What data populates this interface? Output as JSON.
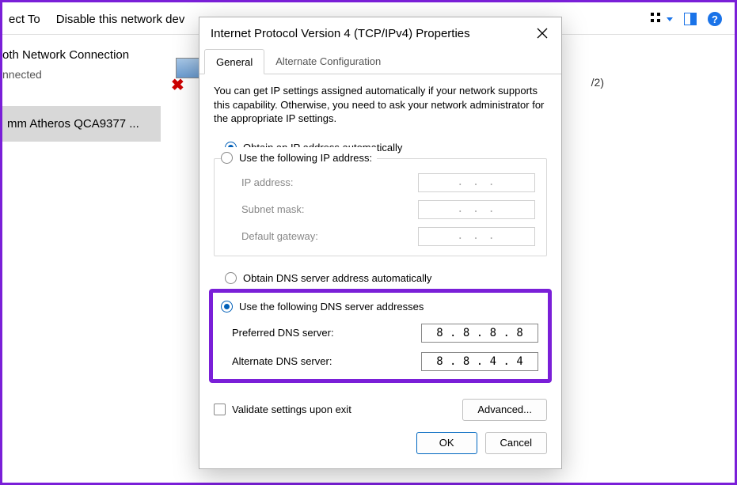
{
  "toolbar": {
    "connect_to": "ect To",
    "disable": "Disable this network dev",
    "view_icon": "grid-icon",
    "pane_icon": "pane-icon",
    "help_icon": "?"
  },
  "sidebar": {
    "title": "oth Network Connection",
    "status": "nnected",
    "selected_adapter": "mm Atheros QCA9377 ..."
  },
  "v2_text": "/2)",
  "dialog": {
    "title": "Internet Protocol Version 4 (TCP/IPv4) Properties",
    "tabs": {
      "general": "General",
      "alternate": "Alternate Configuration"
    },
    "intro": "You can get IP settings assigned automatically if your network supports this capability. Otherwise, you need to ask your network administrator for the appropriate IP settings.",
    "ip": {
      "auto_label": "Obtain an IP address automatically",
      "manual_label": "Use the following IP address:",
      "ip_label": "IP address:",
      "subnet_label": "Subnet mask:",
      "gateway_label": "Default gateway:",
      "dots": ".       .       ."
    },
    "dns": {
      "auto_label": "Obtain DNS server address automatically",
      "manual_label": "Use the following DNS server addresses",
      "preferred_label": "Preferred DNS server:",
      "alternate_label": "Alternate DNS server:",
      "preferred_value": "8 . 8 . 8 . 8",
      "alternate_value": "8 . 8 . 4 . 4"
    },
    "validate_label": "Validate settings upon exit",
    "advanced_label": "Advanced...",
    "ok_label": "OK",
    "cancel_label": "Cancel"
  }
}
